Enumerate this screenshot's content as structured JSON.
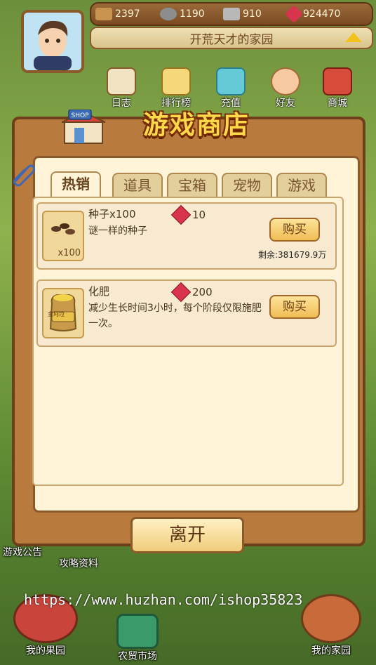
{
  "hud": {
    "resources": [
      {
        "icon": "wood-icon",
        "value": "2397",
        "color": "#c8924f"
      },
      {
        "icon": "stone-icon",
        "value": "1190",
        "color": "#8d8d8d"
      },
      {
        "icon": "iron-icon",
        "value": "910",
        "color": "#b8b8b8"
      },
      {
        "icon": "gem-icon",
        "value": "924470",
        "color": "#d8344e"
      }
    ],
    "farm_name": "开荒天才的家园"
  },
  "nav": {
    "items": [
      {
        "icon": "diary-icon",
        "label": "日志"
      },
      {
        "icon": "ranking-icon",
        "label": "排行榜"
      },
      {
        "icon": "recharge-icon",
        "label": "充值"
      },
      {
        "icon": "friends-icon",
        "label": "好友"
      },
      {
        "icon": "mall-icon",
        "label": "商城"
      }
    ]
  },
  "modal": {
    "title": "游戏商店",
    "shop_sign": "SHOP",
    "tabs": [
      {
        "label": "热销",
        "active": true
      },
      {
        "label": "道具",
        "active": false
      },
      {
        "label": "宝箱",
        "active": false
      },
      {
        "label": "宠物",
        "active": false
      },
      {
        "label": "游戏",
        "active": false
      }
    ],
    "items": [
      {
        "name": "种子x100",
        "description": "谜一样的种子",
        "price": "10",
        "thumb_count": "x100",
        "buy_label": "购买",
        "stock": "剩余:381679.9万"
      },
      {
        "name": "化肥",
        "description": "减少生长时间3小时，每个阶段仅限施肥一次。",
        "price": "200",
        "thumb_badge": "金坷垃",
        "buy_label": "购买"
      }
    ],
    "leave_label": "离开"
  },
  "background_labels": {
    "announcement": "游戏公告",
    "guide": "攻略资料",
    "my_orchard": "我的果园",
    "farm_market": "农贸市场",
    "my_home": "我的家园"
  },
  "watermark": "https://www.huzhan.com/ishop35823"
}
